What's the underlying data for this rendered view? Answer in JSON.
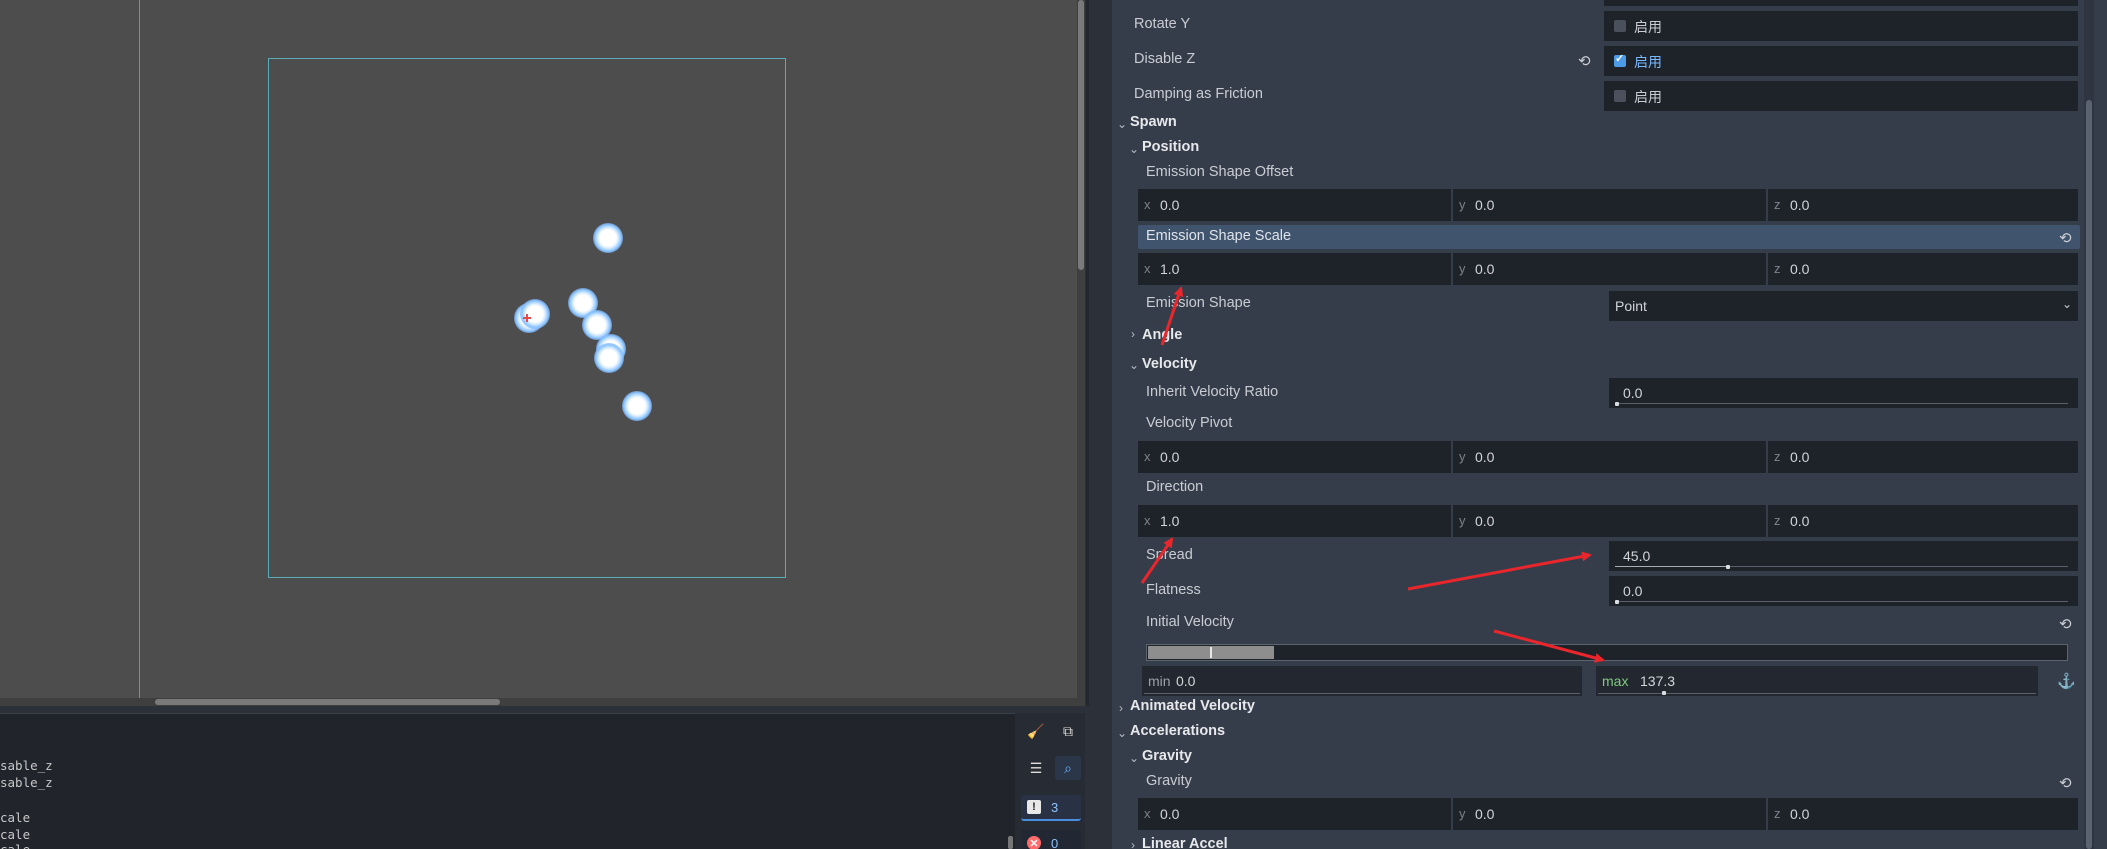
{
  "inspector": {
    "rotate_y": {
      "label": "Rotate Y",
      "value": "启用",
      "checked": false
    },
    "disable_z": {
      "label": "Disable Z",
      "value": "启用",
      "checked": true
    },
    "damping_friction": {
      "label": "Damping as Friction",
      "value": "启用",
      "checked": false
    },
    "spawn": {
      "title": "Spawn",
      "position": {
        "title": "Position",
        "emission_shape_offset": {
          "label": "Emission Shape Offset",
          "x": "0.0",
          "y": "0.0",
          "z": "0.0"
        },
        "emission_shape_scale": {
          "label": "Emission Shape Scale",
          "x": "1.0",
          "y": "0.0",
          "z": "0.0"
        },
        "emission_shape": {
          "label": "Emission Shape",
          "value": "Point"
        }
      },
      "angle": {
        "title": "Angle"
      },
      "velocity": {
        "title": "Velocity",
        "inherit_velocity_ratio": {
          "label": "Inherit Velocity Ratio",
          "value": "0.0"
        },
        "velocity_pivot": {
          "label": "Velocity Pivot",
          "x": "0.0",
          "y": "0.0",
          "z": "0.0"
        },
        "direction": {
          "label": "Direction",
          "x": "1.0",
          "y": "0.0",
          "z": "0.0"
        },
        "spread": {
          "label": "Spread",
          "value": "45.0",
          "fraction": 0.25
        },
        "flatness": {
          "label": "Flatness",
          "value": "0.0"
        },
        "initial_velocity": {
          "label": "Initial Velocity",
          "min_label": "min",
          "min": "0.0",
          "max_label": "max",
          "max": "137.3"
        }
      }
    },
    "animated_velocity": {
      "title": "Animated Velocity"
    },
    "accelerations": {
      "title": "Accelerations",
      "gravity_group": {
        "title": "Gravity"
      },
      "gravity": {
        "label": "Gravity",
        "x": "0.0",
        "y": "0.0",
        "z": "0.0"
      },
      "linear_accel": {
        "title": "Linear Accel"
      }
    },
    "axis_labels": {
      "x": "x",
      "y": "y",
      "z": "z"
    }
  },
  "output": {
    "lines": [
      "sable_z",
      "sable_z",
      "",
      "cale",
      "cale",
      "cale"
    ],
    "warnings_count": "3",
    "errors_count": "0"
  },
  "icons": {
    "reset": "reset-icon",
    "anchor": "anchor-icon",
    "clear": "broom-icon",
    "copy": "copy-icon",
    "collapse": "collapse-icon",
    "search": "search-icon"
  },
  "colors": {
    "accent": "#4d9be6",
    "annotation_arrow": "#e8262b",
    "guide": "#5ab8c4"
  }
}
